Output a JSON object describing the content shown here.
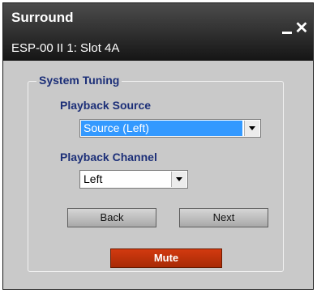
{
  "window": {
    "title": "Surround",
    "subtitle": "ESP-00 II 1: Slot 4A",
    "minimize_icon": "minimize-icon",
    "close_icon": "close-icon",
    "close_glyph": "✕"
  },
  "group": {
    "title": "System Tuning",
    "playback_source": {
      "label": "Playback Source",
      "value": "Source (Left)"
    },
    "playback_channel": {
      "label": "Playback Channel",
      "value": "Left"
    }
  },
  "buttons": {
    "back": "Back",
    "next": "Next",
    "mute": "Mute"
  },
  "colors": {
    "panel_bg": "#c9c9c9",
    "label_text": "#1c2f78",
    "selected_highlight": "#3399ff",
    "mute_button": "#c0320a",
    "titlebar": "#2b2b2b"
  }
}
